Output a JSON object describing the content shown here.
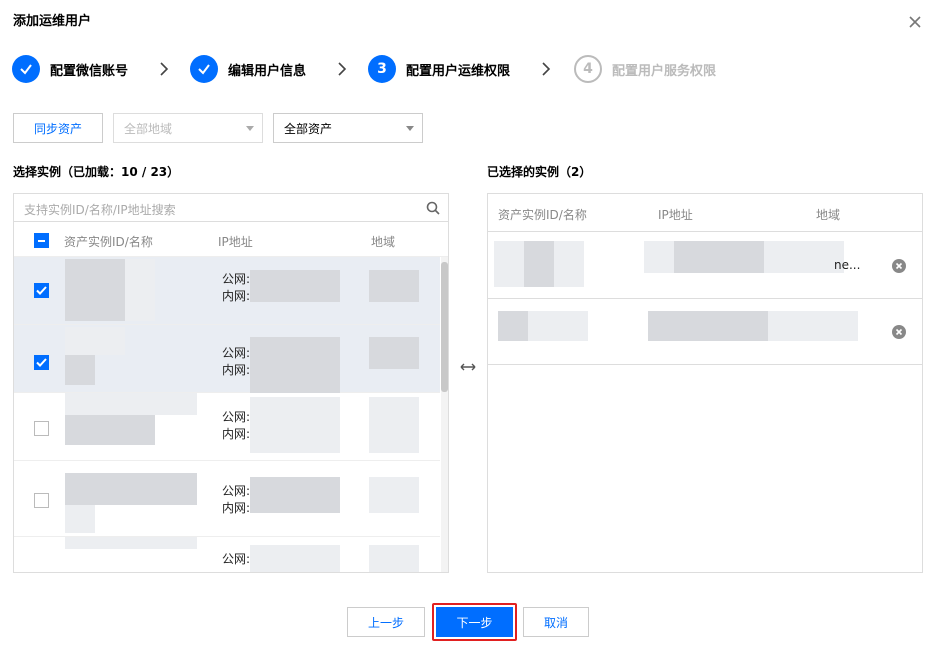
{
  "dialog": {
    "title": "添加运维用户",
    "close_icon": "close-icon"
  },
  "steps": [
    {
      "index": "1",
      "label": "配置微信账号",
      "state": "done"
    },
    {
      "index": "2",
      "label": "编辑用户信息",
      "state": "done"
    },
    {
      "index": "3",
      "label": "配置用户运维权限",
      "state": "active"
    },
    {
      "index": "4",
      "label": "配置用户服务权限",
      "state": "todo"
    }
  ],
  "toolbar": {
    "sync_label": "同步资产",
    "region_select": "全部地域",
    "asset_select": "全部资产"
  },
  "left": {
    "title": "选择实例（已加载：10 / 23）",
    "search_placeholder": "支持实例ID/名称/IP地址搜索",
    "columns": [
      "资产实例ID/名称",
      "IP地址",
      "地域"
    ],
    "rows": [
      {
        "selected": true,
        "public": "公网:",
        "private": "内网:"
      },
      {
        "selected": true,
        "public": "公网:",
        "private": "内网:"
      },
      {
        "selected": false,
        "public": "公网:",
        "private": "内网:"
      },
      {
        "selected": false,
        "public": "公网:",
        "private": "内网:"
      },
      {
        "selected": false,
        "public": "公网:",
        "private": ""
      }
    ]
  },
  "right": {
    "title": "已选择的实例（2）",
    "columns": [
      "资产实例ID/名称",
      "IP地址",
      "地域"
    ],
    "rows": [
      {
        "region_suffix": "ne..."
      },
      {
        "region_suffix": ""
      }
    ]
  },
  "footer": {
    "prev_label": "上一步",
    "next_label": "下一步",
    "cancel_label": "取消"
  },
  "colors": {
    "primary": "#006eff",
    "highlight": "#e12020"
  }
}
